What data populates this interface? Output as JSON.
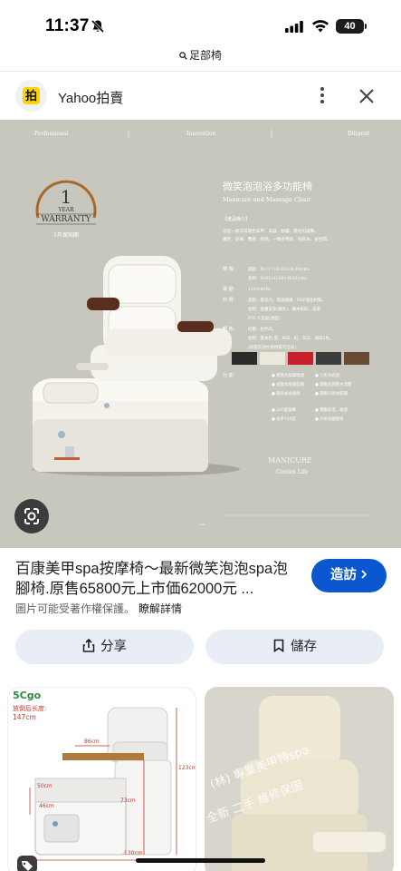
{
  "status_bar": {
    "time": "11:37",
    "battery": "40"
  },
  "url_bar": {
    "text": "足部椅"
  },
  "source": {
    "logo_text": "拍",
    "name": "Yahoo拍賣"
  },
  "ad_image": {
    "nav": [
      "Professional",
      "Innovation",
      "Diligent"
    ],
    "warranty": {
      "number": "1",
      "year": "YEAR",
      "label": "WARRANTY",
      "caption": "1年保固期"
    },
    "title": "微笑泡泡浴多功能椅",
    "subtitle": "Manicure and Massage Chair",
    "section_label": "【產品簡介】",
    "intro": [
      "這是一款非常適合美甲、美容、紋繡、睫毛的設備，",
      "穩定、舒適、豐感、耐適，一機多用途，省成本、省空間。"
    ],
    "specs": [
      {
        "label": "規 格：",
        "lines": [
          "座鋁：W:117×D:65×H:49(cm)",
          "座椅：W:85×D:60×H:93(cm)"
        ]
      },
      {
        "label": "電 壓：",
        "lines": [
          "110V(80W)"
        ]
      },
      {
        "label": "材 質：",
        "lines": [
          "座鋁：壓克力、玻璃纖維、FRP強化材質。",
          "座椅：金屬支架(鐵毛)、鐵木布料、皮革、",
          "PVC人造皮(選配)"
        ]
      },
      {
        "label": "顏 色：",
        "lines": [
          "紅體：拉伸白。",
          "座椅：基本色-黑、米白、紅、灰灰、咖啡5色。",
          "(如需其他色系材質可洽詢)"
        ]
      }
    ],
    "functions_label": "功 能：",
    "functions": [
      [
        "無管式按摩噴頭",
        "七彩水底燈"
      ],
      [
        "按壓式排廢開關",
        "鏡壓式調整水流閥"
      ],
      [
        "兩段式水龍頭",
        "鋼製冷熱水開關"
      ],
      [
        "360度旋轉",
        "電動前進、後退"
      ],
      [
        "扶手180度",
        "外掛式腳墊架"
      ]
    ],
    "footer_brand": "MANICURE",
    "footer_sub": "Conten Life",
    "swatch_colors": [
      "#2b2b2b",
      "#ece8dc",
      "#c8202a",
      "#3d3d3d",
      "#6b4a34"
    ]
  },
  "result": {
    "title": "百康美甲spa按摩椅～最新微笑泡泡spa泡腳椅.原售65800元上市価62000元 ...",
    "visit_label": "造訪",
    "copyright_note": "圖片可能受著作權保護。",
    "learn_more": "瞭解詳情"
  },
  "actions": {
    "share_label": "分享",
    "save_label": "儲存"
  },
  "thumbnails": {
    "left": {
      "brand": "5Cgo",
      "length_label": "放倒后长度:",
      "length_value": "147cm",
      "dims": [
        "86cm",
        "123cm",
        "73cm",
        "50cm",
        "46cm",
        "130cm"
      ]
    },
    "right": {
      "watermark_lines": [
        "(林) 專業美甲特spa",
        "全新 二手 維修保固"
      ]
    }
  }
}
